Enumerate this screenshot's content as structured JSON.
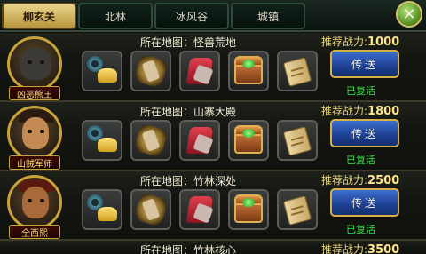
{
  "tabs": [
    {
      "label": "柳玄关",
      "active": true
    },
    {
      "label": "北林",
      "active": false
    },
    {
      "label": "冰风谷",
      "active": false
    },
    {
      "label": "城镇",
      "active": false
    }
  ],
  "close_icon": "close-x-icon",
  "rows": [
    {
      "boss_name": "凶恶熊王",
      "portrait": "bear-boss-portrait",
      "location": "所在地图：怪兽荒地",
      "power_label": "推荐战力:",
      "power_value": "1000",
      "button_label": "传送",
      "status": "已复活"
    },
    {
      "boss_name": "山贼军师",
      "portrait": "bandit-strategist-portrait",
      "location": "所在地图：山寨大殿",
      "power_label": "推荐战力:",
      "power_value": "1800",
      "button_label": "传送",
      "status": "已复活"
    },
    {
      "boss_name": "全西熙",
      "portrait": "warrior-portrait",
      "location": "所在地图：竹林深处",
      "power_label": "推荐战力:",
      "power_value": "2500",
      "button_label": "传送",
      "status": "已复活"
    },
    {
      "location": "所在地图：竹林核心",
      "power_label": "推荐战力:",
      "power_value": "3500"
    }
  ],
  "reward_icons": [
    "jade-gold-ingot-icon",
    "gear-pile-icon",
    "red-robe-icon",
    "treasure-chest-icon",
    "scroll-icon"
  ],
  "colors": {
    "tab_active": "#d8be6a",
    "go_button": "#2a56b8",
    "revived_text": "#38e84a",
    "power_text": "#e8d478"
  }
}
